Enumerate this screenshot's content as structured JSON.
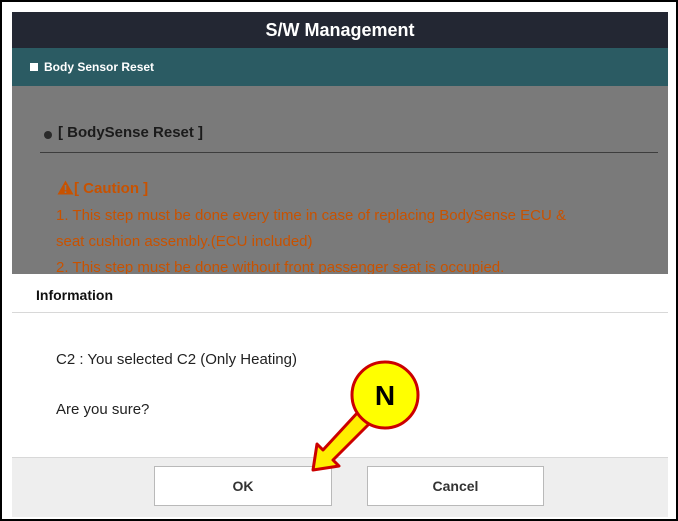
{
  "window": {
    "title": "S/W Management"
  },
  "section": {
    "title": "Body Sensor Reset"
  },
  "content": {
    "heading": "[ BodySense Reset ]",
    "caution_label": "[ Caution ]",
    "steps": [
      "1. This step must be done every time in case of replacing BodySense ECU &",
      "seat cushion assembly.(ECU included)",
      "2. This step must be done without front passenger seat is occupied."
    ]
  },
  "dialog": {
    "title": "Information",
    "message": "C2 : You selected C2 (Only Heating)",
    "question": "Are you sure?",
    "ok_label": "OK",
    "cancel_label": "Cancel"
  },
  "annotation": {
    "marker": "N",
    "marker_color": "#ffff00",
    "marker_border": "#cc0000"
  },
  "colors": {
    "titlebar": "#232733",
    "section_bar": "#2b5b63",
    "caution_text": "#c85200"
  }
}
